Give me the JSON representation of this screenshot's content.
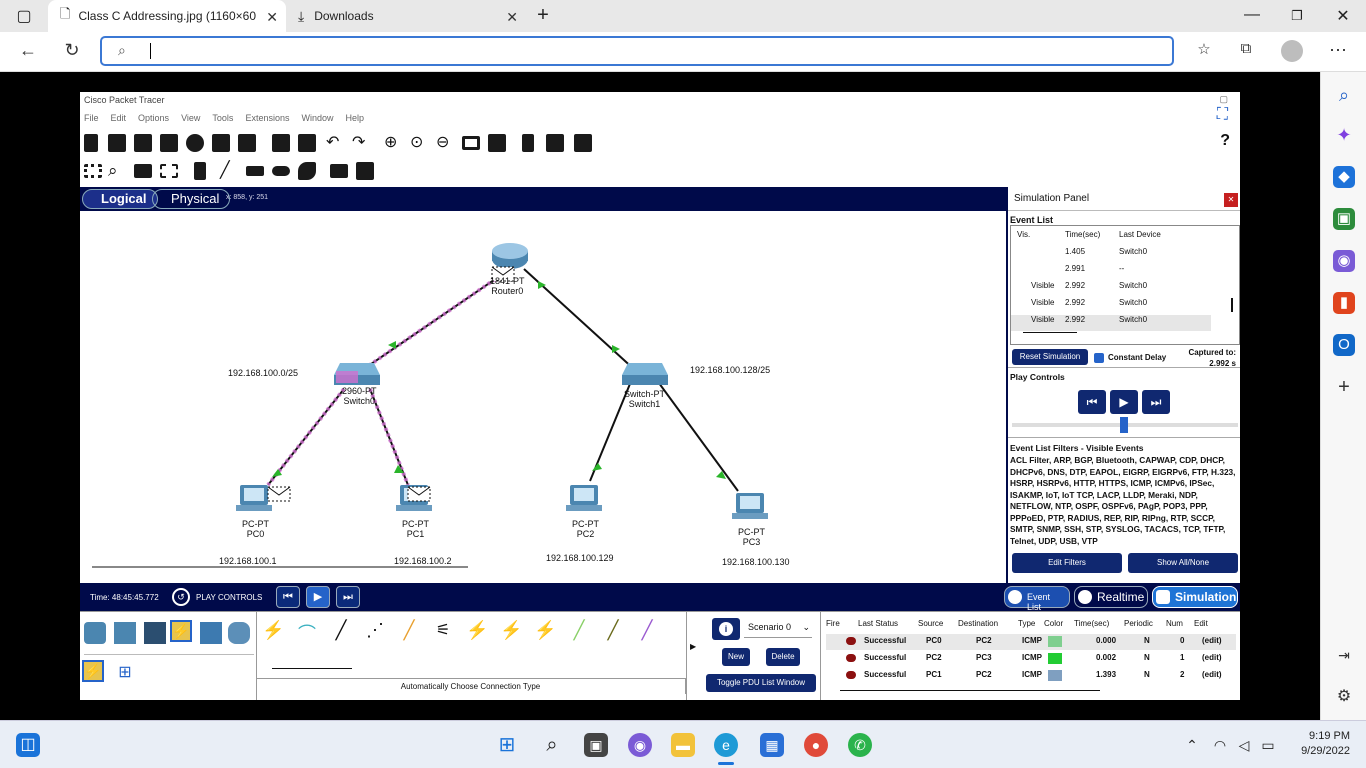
{
  "browser": {
    "tabs": [
      {
        "title": "Class C Addressing.jpg (1160×60"
      },
      {
        "title": "Downloads"
      }
    ],
    "address_value": "",
    "new_tab": "+"
  },
  "app": {
    "title": "Cisco Packet Tracer",
    "menu": [
      "File",
      "Edit",
      "Options",
      "View",
      "Tools",
      "Extensions",
      "Window",
      "Help"
    ],
    "help_symbol": "?",
    "view_tabs": {
      "logical": "Logical",
      "physical": "Physical",
      "coords": "x: 858, y: 251"
    },
    "network": {
      "router": {
        "type": "1841-PT",
        "name": "Router0"
      },
      "switch0": {
        "type": "2960-PT",
        "name": "Switch0"
      },
      "switch1": {
        "type": "Switch-PT",
        "name": "Switch1"
      },
      "subnet_left": "192.168.100.0/25",
      "subnet_right": "192.168.100.128/25",
      "pcs": [
        {
          "type": "PC-PT",
          "name": "PC0",
          "ip": "192.168.100.1"
        },
        {
          "type": "PC-PT",
          "name": "PC1",
          "ip": "192.168.100.2"
        },
        {
          "type": "PC-PT",
          "name": "PC2",
          "ip": "192.168.100.129"
        },
        {
          "type": "PC-PT",
          "name": "PC3",
          "ip": "192.168.100.130"
        }
      ]
    },
    "simulation_panel": {
      "title": "Simulation Panel",
      "event_list_label": "Event List",
      "columns": [
        "Vis.",
        "Time(sec)",
        "Last Device"
      ],
      "events": [
        {
          "vis": "",
          "time": "1.405",
          "device": "Switch0"
        },
        {
          "vis": "",
          "time": "2.991",
          "device": "--"
        },
        {
          "vis": "Visible",
          "time": "2.992",
          "device": "Switch0"
        },
        {
          "vis": "Visible",
          "time": "2.992",
          "device": "Switch0"
        },
        {
          "vis": "Visible",
          "time": "2.992",
          "device": "Switch0"
        }
      ],
      "reset_label": "Reset Simulation",
      "constant_delay_label": "Constant Delay",
      "captured_label": "Captured to:",
      "captured_value": "2.992 s",
      "play_controls_label": "Play Controls",
      "filters_label": "Event List Filters - Visible Events",
      "filters_text": "ACL Filter, ARP, BGP, Bluetooth, CAPWAP, CDP, DHCP, DHCPv6, DNS, DTP, EAPOL, EIGRP, EIGRPv6, FTP, H.323, HSRP, HSRPv6, HTTP, HTTPS, ICMP, ICMPv6, IPSec, ISAKMP, IoT, IoT TCP, LACP, LLDP, Meraki, NDP, NETFLOW, NTP, OSPF, OSPFv6, PAgP, POP3, PPP, PPPoED, PTP, RADIUS, REP, RIP, RIPng, RTP, SCCP, SMTP, SNMP, SSH, STP, SYSLOG, TACACS, TCP, TFTP, Telnet, UDP, USB, VTP",
      "edit_filters": "Edit Filters",
      "show_all": "Show All/None"
    },
    "bottom_bar": {
      "time": "Time: 48:45:45.772",
      "play_controls": "PLAY CONTROLS",
      "event_list": "Event List",
      "realtime": "Realtime",
      "simulation": "Simulation"
    },
    "tray": {
      "connection_type": "Automatically Choose Connection Type",
      "scenario": "Scenario 0",
      "new": "New",
      "delete": "Delete",
      "toggle_pdu": "Toggle PDU List Window",
      "pdu_columns": [
        "Fire",
        "Last Status",
        "Source",
        "Destination",
        "Type",
        "Color",
        "Time(sec)",
        "Periodic",
        "Num",
        "Edit"
      ],
      "pdus": [
        {
          "status": "Successful",
          "source": "PC0",
          "dest": "PC2",
          "type": "ICMP",
          "color": "#7fcf8f",
          "time": "0.000",
          "periodic": "N",
          "num": "0",
          "edit": "(edit)"
        },
        {
          "status": "Successful",
          "source": "PC2",
          "dest": "PC3",
          "type": "ICMP",
          "color": "#22cc33",
          "time": "0.002",
          "periodic": "N",
          "num": "1",
          "edit": "(edit)"
        },
        {
          "status": "Successful",
          "source": "PC1",
          "dest": "PC2",
          "type": "ICMP",
          "color": "#7f9fc0",
          "time": "1.393",
          "periodic": "N",
          "num": "2",
          "edit": "(edit)"
        }
      ]
    }
  },
  "taskbar": {
    "time": "9:19 PM",
    "date": "9/29/2022"
  },
  "colors": {
    "pt_navy": "#000a4a",
    "accent_blue": "#3b78d4",
    "link_green": "#2bb52b",
    "highlight_pink": "#d070d0"
  }
}
